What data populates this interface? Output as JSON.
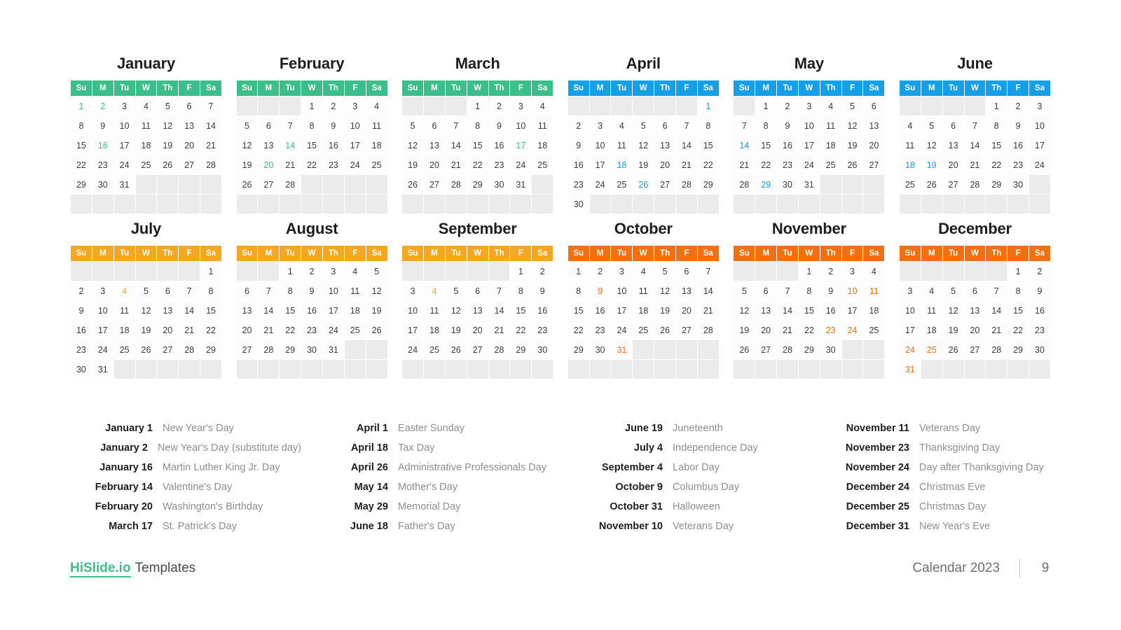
{
  "footer": {
    "brand_primary": "HiSlide.io",
    "brand_secondary": "Templates",
    "title": "Calendar 2023",
    "page_number": "9"
  },
  "weekday_headers": [
    "Su",
    "M",
    "Tu",
    "W",
    "Th",
    "F",
    "Sa"
  ],
  "palette": {
    "q1_green": "#3bbf8a",
    "q2_blue": "#14a0e8",
    "q3_yellow": "#f5a623",
    "q4_orange": "#f2700f",
    "empty_cell": "#ebebeb",
    "day_text": "#3a3a3a",
    "holiday_name": "#8e8e93"
  },
  "months": [
    {
      "name": "January",
      "quarter": "q1",
      "lead_blanks": 0,
      "days_in_month": 31,
      "highlighted": [
        1,
        2,
        16
      ]
    },
    {
      "name": "February",
      "quarter": "q1",
      "lead_blanks": 3,
      "days_in_month": 28,
      "highlighted": [
        14,
        20
      ]
    },
    {
      "name": "March",
      "quarter": "q1",
      "lead_blanks": 3,
      "days_in_month": 31,
      "highlighted": [
        17
      ]
    },
    {
      "name": "April",
      "quarter": "q2",
      "lead_blanks": 6,
      "days_in_month": 30,
      "highlighted": [
        1,
        18,
        26
      ]
    },
    {
      "name": "May",
      "quarter": "q2",
      "lead_blanks": 1,
      "days_in_month": 31,
      "highlighted": [
        14,
        29
      ]
    },
    {
      "name": "June",
      "quarter": "q2",
      "lead_blanks": 4,
      "days_in_month": 30,
      "highlighted": [
        18,
        19
      ]
    },
    {
      "name": "July",
      "quarter": "q3",
      "lead_blanks": 6,
      "days_in_month": 31,
      "highlighted": [
        4
      ]
    },
    {
      "name": "August",
      "quarter": "q3",
      "lead_blanks": 2,
      "days_in_month": 31,
      "highlighted": []
    },
    {
      "name": "September",
      "quarter": "q3",
      "lead_blanks": 5,
      "days_in_month": 30,
      "highlighted": [
        4
      ]
    },
    {
      "name": "October",
      "quarter": "q4",
      "lead_blanks": 0,
      "days_in_month": 31,
      "highlighted": [
        9,
        31
      ]
    },
    {
      "name": "November",
      "quarter": "q4",
      "lead_blanks": 3,
      "days_in_month": 30,
      "highlighted": [
        10,
        11,
        23,
        24
      ]
    },
    {
      "name": "December",
      "quarter": "q4",
      "lead_blanks": 5,
      "days_in_month": 31,
      "highlighted": [
        24,
        25,
        31
      ]
    }
  ],
  "holiday_columns": [
    [
      {
        "date": "January 1",
        "name": "New Year's Day"
      },
      {
        "date": "January 2",
        "name": "New Year's Day (substitute day)"
      },
      {
        "date": "January 16",
        "name": "Martin Luther King Jr. Day"
      },
      {
        "date": "February 14",
        "name": "Valentine's Day"
      },
      {
        "date": "February 20",
        "name": "Washington's Birthday"
      },
      {
        "date": "March 17",
        "name": "St. Patrick's Day"
      }
    ],
    [
      {
        "date": "April 1",
        "name": "Easter Sunday"
      },
      {
        "date": "April 18",
        "name": "Tax Day"
      },
      {
        "date": "April 26",
        "name": "Administrative Professionals Day"
      },
      {
        "date": "May 14",
        "name": "Mother's Day"
      },
      {
        "date": "May 29",
        "name": "Memorial Day"
      },
      {
        "date": "June 18",
        "name": "Father's Day"
      }
    ],
    [
      {
        "date": "June 19",
        "name": "Juneteenth"
      },
      {
        "date": "July 4",
        "name": "Independence Day"
      },
      {
        "date": "September 4",
        "name": "Labor Day"
      },
      {
        "date": "October 9",
        "name": "Columbus Day"
      },
      {
        "date": "October 31",
        "name": "Halloween"
      },
      {
        "date": "November 10",
        "name": "Veterans Day"
      }
    ],
    [
      {
        "date": "November 11",
        "name": "Veterans Day"
      },
      {
        "date": "November 23",
        "name": "Thanksgiving Day"
      },
      {
        "date": "November 24",
        "name": "Day after Thanksgiving Day"
      },
      {
        "date": "December 24",
        "name": "Christmas Eve"
      },
      {
        "date": "December 25",
        "name": "Christmas Day"
      },
      {
        "date": "December 31",
        "name": "New Year's Eve"
      }
    ]
  ]
}
